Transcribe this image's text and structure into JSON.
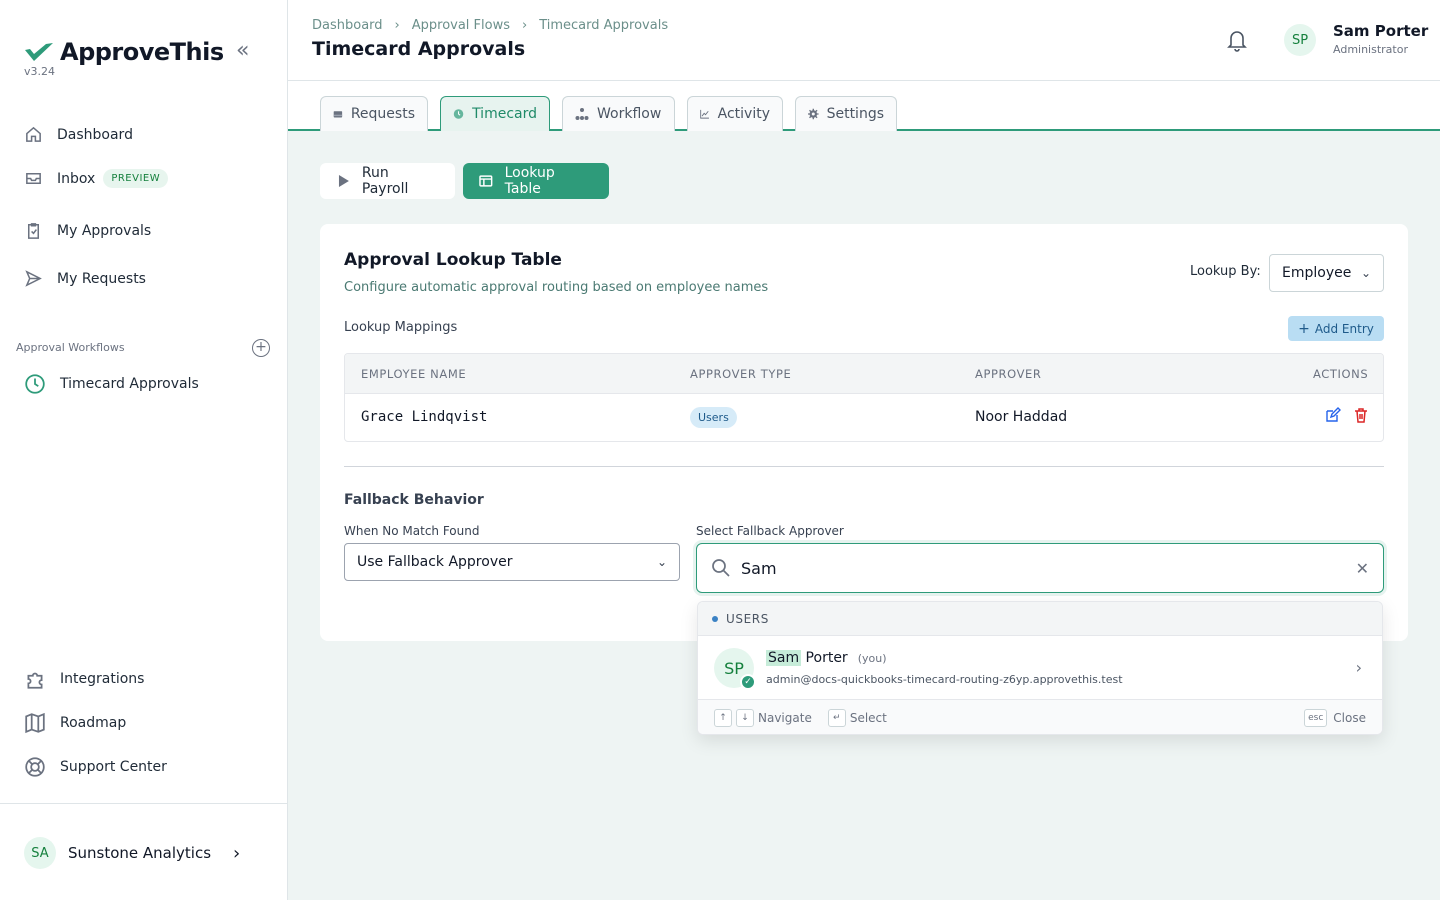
{
  "app": {
    "name": "ApproveThis",
    "version": "v3.24",
    "accent": "#2e9b7a"
  },
  "sidebar": {
    "items": [
      {
        "label": "Dashboard",
        "icon": "home-icon"
      },
      {
        "label": "Inbox",
        "icon": "inbox-icon",
        "badge": "PREVIEW"
      },
      {
        "label": "My Approvals",
        "icon": "clipboard-icon"
      },
      {
        "label": "My Requests",
        "icon": "send-icon"
      }
    ],
    "section_label": "Approval Workflows",
    "workflows": [
      {
        "label": "Timecard Approvals",
        "icon": "clock-icon"
      }
    ],
    "bottom_items": [
      {
        "label": "Integrations",
        "icon": "puzzle-icon"
      },
      {
        "label": "Roadmap",
        "icon": "map-icon"
      },
      {
        "label": "Support Center",
        "icon": "lifebuoy-icon"
      }
    ],
    "org": {
      "initials": "SA",
      "name": "Sunstone Analytics"
    }
  },
  "header": {
    "breadcrumb": [
      "Dashboard",
      "Approval Flows",
      "Timecard Approvals"
    ],
    "title": "Timecard Approvals",
    "user": {
      "initials": "SP",
      "name": "Sam Porter",
      "role": "Administrator"
    }
  },
  "tabs": [
    {
      "label": "Requests",
      "icon": "inbox-tray-icon"
    },
    {
      "label": "Timecard",
      "icon": "clock-icon",
      "active": true
    },
    {
      "label": "Workflow",
      "icon": "workflow-icon"
    },
    {
      "label": "Activity",
      "icon": "chart-line-icon"
    },
    {
      "label": "Settings",
      "icon": "gear-icon"
    }
  ],
  "subtabs": {
    "run_payroll": "Run Payroll",
    "lookup_table": "Lookup Table"
  },
  "card": {
    "title": "Approval Lookup Table",
    "subtitle": "Configure automatic approval routing based on employee names",
    "lookup_by_label": "Lookup By:",
    "lookup_by_value": "Employee",
    "mappings_label": "Lookup Mappings",
    "add_entry": "Add Entry",
    "columns": [
      "EMPLOYEE NAME",
      "APPROVER TYPE",
      "APPROVER",
      "ACTIONS"
    ],
    "rows": [
      {
        "employee": "Grace Lindqvist",
        "type": "Users",
        "approver": "Noor Haddad"
      }
    ],
    "fallback_title": "Fallback Behavior",
    "when_no_match_label": "When No Match Found",
    "when_no_match_value": "Use Fallback Approver",
    "select_fallback_label": "Select Fallback Approver",
    "search_value": "Sam"
  },
  "dropdown": {
    "group": "USERS",
    "result": {
      "initials": "SP",
      "match": "Sam",
      "rest": " Porter",
      "you": "(you)",
      "email": "admin@docs-quickbooks-timecard-routing-z6yp.approvethis.test"
    },
    "footer": {
      "up_key": "↑",
      "down_key": "↓",
      "navigate": "Navigate",
      "enter_key": "↵",
      "select": "Select",
      "esc_key": "esc",
      "close": "Close"
    }
  }
}
